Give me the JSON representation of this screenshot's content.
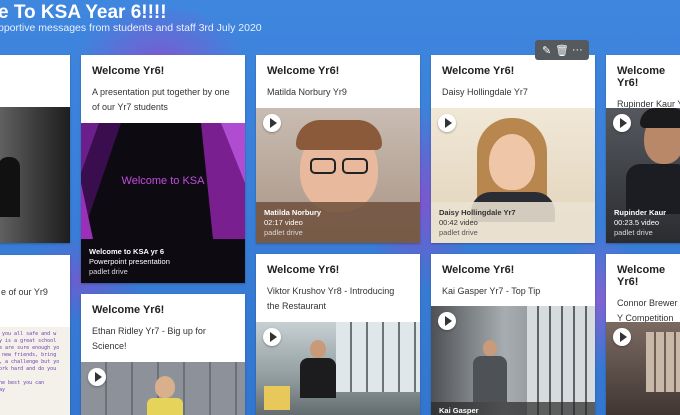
{
  "header": {
    "title": "e To KSA Year 6!!!!",
    "subtitle": "pportive messages from students and staff 3rd July 2020"
  },
  "toolbar": {
    "edit_icon": "✎",
    "delete_icon": "🗑",
    "more_icon": "···"
  },
  "col1": {
    "partial_text": "e of our Yr9",
    "handwriting": "r you all safe and w\nby is a great school\nre are sure enough yo\nh new friends, bring\nd, a challenge but yo\nwork hard and do you\n\nthe best you can\nmay"
  },
  "col2": {
    "card1": {
      "title": "Welcome Yr6!",
      "body": "A presentation put together by one of our Yr7 students",
      "slide_text": "Welcome to KSA",
      "caption_title": "Welcome to KSA yr 6",
      "caption_type": "Powerpoint presentation",
      "caption_source": "padlet drive"
    },
    "card2": {
      "title": "Welcome Yr6!",
      "body": "Ethan Ridley Yr7 - Big up for Science!"
    }
  },
  "col3": {
    "card1": {
      "title": "Welcome Yr6!",
      "body": "Matilda Norbury Yr9",
      "caption_title": "Matilda Norbury",
      "caption_duration": "02:17 video",
      "caption_source": "padlet drive"
    },
    "card2": {
      "title": "Welcome Yr6!",
      "body": "Viktor Krushov Yr8 - Introducing the Restaurant"
    }
  },
  "col4": {
    "card1": {
      "title": "Welcome Yr6!",
      "body": "Daisy Hollingdale Yr7",
      "caption_title": "Daisy Hollingdale Yr7",
      "caption_duration": "00:42 video",
      "caption_source": "padlet drive"
    },
    "card2": {
      "title": "Welcome Yr6!",
      "body": "Kai Gasper Yr7 - Top Tip",
      "caption_title": "Kai Gasper"
    }
  },
  "col5": {
    "card1": {
      "title": "Welcome Yr6!",
      "body": "Rupinder Kaur Yr",
      "caption_title": "Rupinder Kaur",
      "caption_duration": "00:23.5 video",
      "caption_source": "padlet drive"
    },
    "card2": {
      "title": "Welcome Yr6!",
      "body": "Connor Brewer Y Competition"
    }
  }
}
